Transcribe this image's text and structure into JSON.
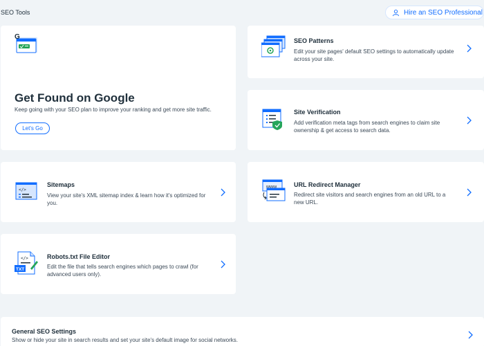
{
  "header": {
    "title": "SEO Tools",
    "hire_button": "Hire an SEO Professional"
  },
  "hero": {
    "title": "Get Found on Google",
    "description": "Keep going with your SEO plan to improve your ranking and get more site traffic.",
    "button": "Let's Go"
  },
  "tools": {
    "seo_patterns": {
      "title": "SEO Patterns",
      "description": "Edit your site pages' default SEO settings to automatically update across your site."
    },
    "site_verification": {
      "title": "Site Verification",
      "description": "Add verification meta tags from search engines to claim site ownership & get access to search data."
    },
    "sitemaps": {
      "title": "Sitemaps",
      "description": "View your site's XML sitemap index & learn how it's optimized for you."
    },
    "url_redirect": {
      "title": "URL Redirect Manager",
      "description": "Redirect site visitors and search engines from an old URL to a new URL.",
      "icon_text": "www"
    },
    "robots": {
      "title": "Robots.txt File Editor",
      "description": "Edit the file that tells search engines which pages to crawl (for advanced users only).",
      "icon_text": "TXT"
    },
    "general_settings": {
      "title": "General SEO Settings",
      "description": "Show or hide your site in search results and set your site's default image for social networks."
    }
  },
  "icons": {
    "hire": "person-icon",
    "chevron": "chevron-right-icon",
    "google_logo_letter": "G"
  },
  "colors": {
    "accent": "#116dff",
    "background": "#f0f4f7",
    "green": "#25a55a"
  }
}
